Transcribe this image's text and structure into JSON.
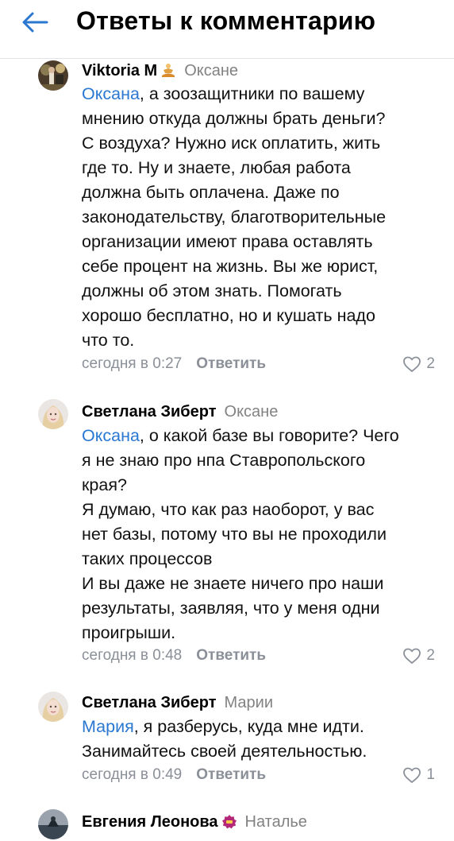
{
  "header": {
    "title": "Ответы к комментарию",
    "back_icon": "arrow-left-icon"
  },
  "colors": {
    "accent": "#2a78d2",
    "muted": "#8a8f98",
    "divider": "#e3e4e8"
  },
  "comments": [
    {
      "author": "Viktoria M",
      "badge_icon": "meditation-emoji-icon",
      "reply_to": "Оксане",
      "mention": "Оксана",
      "lines": [
        ", а зоозащитники по вашему",
        "мнению откуда должны брать деньги?",
        "С воздуха? Нужно иск оплатить, жить",
        "где то. Ну и знаете, любая работа",
        "должна быть оплачена. Даже по",
        "законодательству, благотворительные",
        "организации имеют права оставлять",
        "себе процент на жизнь. Вы же юрист,",
        "должны об этом знать. Помогать",
        "хорошо бесплатно, но и кушать надо",
        "что то."
      ],
      "time": "сегодня в 0:27",
      "reply_label": "Ответить",
      "likes": "2"
    },
    {
      "author": "Светлана Зиберт",
      "reply_to": "Оксане",
      "mention": "Оксана",
      "lines": [
        ", о какой базе вы говорите? Чего",
        "я не знаю про нпа Ставропольского",
        "края?",
        "Я думаю, что как раз наоборот, у вас",
        "нет базы, потому что вы не проходили",
        "таких процессов",
        "И вы даже не знаете ничего про наши",
        "результаты, заявляя, что у меня одни",
        "проигрыши."
      ],
      "time": "сегодня в 0:48",
      "reply_label": "Ответить",
      "likes": "2"
    },
    {
      "author": "Светлана Зиберт",
      "reply_to": "Марии",
      "mention": "Мария",
      "lines": [
        ", я разберусь, куда мне идти.",
        "Занимайтесь своей деятельностью."
      ],
      "time": "сегодня в 0:49",
      "reply_label": "Ответить",
      "likes": "1"
    },
    {
      "author": "Евгения Леонова",
      "badge_icon": "vip-badge-icon",
      "reply_to": "Наталье"
    }
  ]
}
